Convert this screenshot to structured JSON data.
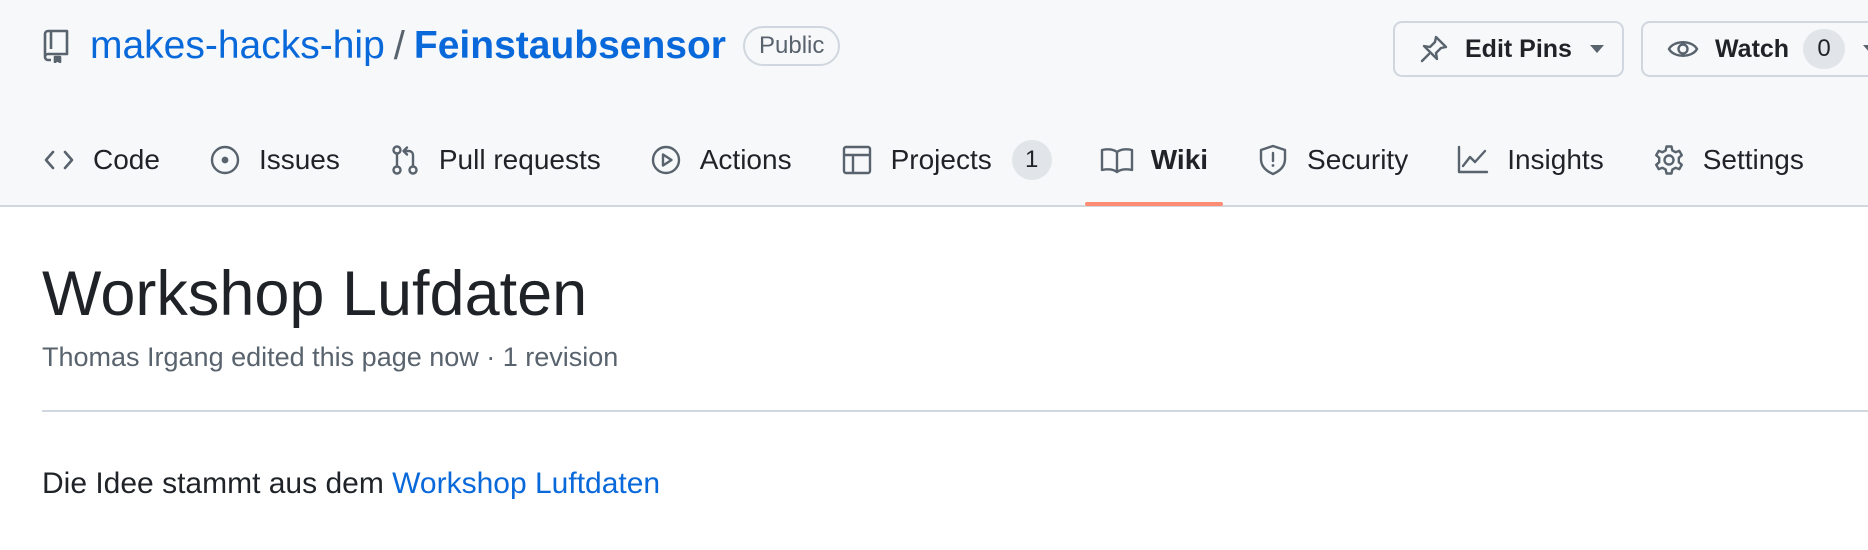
{
  "repo": {
    "owner": "makes-hacks-hip",
    "separator": "/",
    "name": "Feinstaubsensor",
    "visibility": "Public",
    "icon": "repo-icon"
  },
  "actions": {
    "edit_pins": {
      "label": "Edit Pins",
      "icon": "pin-icon"
    },
    "watch": {
      "label": "Watch",
      "count": "0",
      "icon": "eye-icon"
    }
  },
  "tabs": [
    {
      "label": "Code",
      "icon": "code-icon"
    },
    {
      "label": "Issues",
      "icon": "issue-icon"
    },
    {
      "label": "Pull requests",
      "icon": "pull-request-icon"
    },
    {
      "label": "Actions",
      "icon": "play-icon"
    },
    {
      "label": "Projects",
      "icon": "table-icon",
      "count": "1"
    },
    {
      "label": "Wiki",
      "icon": "book-icon",
      "active": true
    },
    {
      "label": "Security",
      "icon": "shield-icon"
    },
    {
      "label": "Insights",
      "icon": "graph-icon"
    },
    {
      "label": "Settings",
      "icon": "gear-icon"
    }
  ],
  "page": {
    "title": "Workshop Lufdaten",
    "meta": "Thomas Irgang edited this page now · 1 revision",
    "body_prefix": "Die Idee stammt aus dem ",
    "body_link": "Workshop Luftdaten"
  },
  "colors": {
    "link": "#0969da",
    "active_tab_underline": "#fd8c73",
    "header_bg": "#f6f8fa",
    "muted_text": "#59636e"
  }
}
